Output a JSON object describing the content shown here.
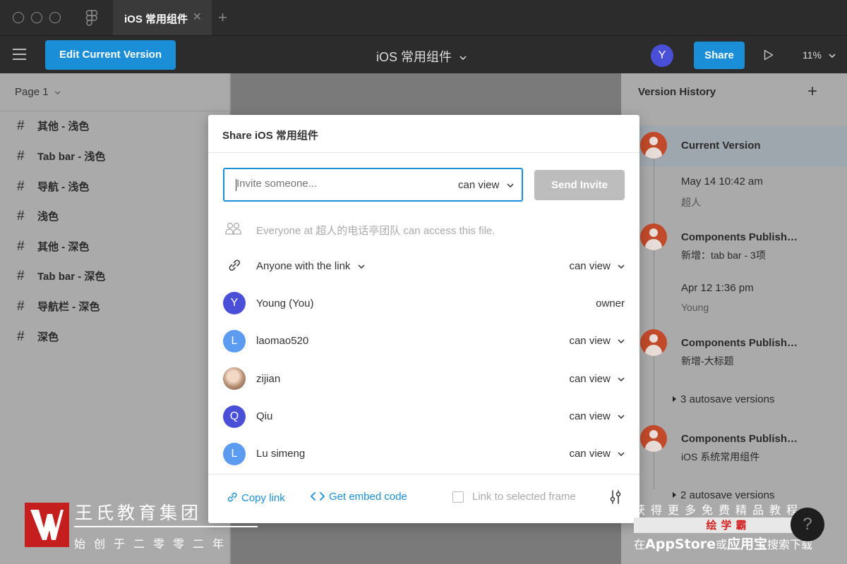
{
  "window": {
    "tab_label": "iOS 常用组件",
    "tab_close": "✕",
    "new_tab": "+"
  },
  "toolbar": {
    "edit_button": "Edit Current Version",
    "file_title": "iOS 常用组件",
    "avatar_initial": "Y",
    "share_button": "Share",
    "zoom": "11%"
  },
  "left_panel": {
    "page_selector": "Page 1",
    "frames": [
      "其他 - 浅色",
      "Tab bar - 浅色",
      "导航 - 浅色",
      "浅色",
      "其他 - 深色",
      "Tab bar - 深色",
      "导航栏 - 深色",
      "深色"
    ]
  },
  "right_panel": {
    "title": "Version History",
    "plus": "+",
    "current_version": "Current Version",
    "v1_date": "May 14 10:42 am",
    "v1_user": "超人",
    "v2_title": "Components Publish…",
    "v2_desc": "新增：tab bar - 3项",
    "v3_date": "Apr 12 1:36 pm",
    "v3_user": "Young",
    "v4_title": "Components Publish…",
    "v4_desc": "新增-大标题",
    "autosave1": "3 autosave versions",
    "v5_title": "Components Publish…",
    "v5_desc": "iOS 系统常用组件",
    "autosave2": "2 autosave versions"
  },
  "modal": {
    "title": "Share iOS 常用组件",
    "invite_placeholder": "Invite someone...",
    "invite_permission": "can view",
    "send_button": "Send Invite",
    "team_access": "Everyone at 超人的电话亭团队 can access this file.",
    "link_access": "Anyone with the link",
    "link_permission": "can view",
    "members": [
      {
        "initial": "Y",
        "name": "Young (You)",
        "permission": "owner",
        "color": "#4a4fd8"
      },
      {
        "initial": "L",
        "name": "laomao520",
        "permission": "can view",
        "color": "#5b9bf0"
      },
      {
        "initial": "",
        "name": "zijian",
        "permission": "can view",
        "color": ""
      },
      {
        "initial": "Q",
        "name": "Qiu",
        "permission": "can view",
        "color": "#4a4fd8"
      },
      {
        "initial": "L",
        "name": "Lu simeng",
        "permission": "can view",
        "color": "#5b9bf0"
      }
    ],
    "copy_link": "Copy link",
    "embed_code": "Get embed code",
    "link_to_frame": "Link to selected frame"
  },
  "watermark": {
    "org_name": "王氏教育集团",
    "org_sub": "始创于二零零二年",
    "right_line1": "获得更多免费精品教程",
    "right_band": "绘学霸",
    "right_line2_prefix": "在",
    "right_line2_app": "AppStore",
    "right_line2_mid": "或",
    "right_line2_store": "应用宝",
    "right_line2_suffix": "搜索下载",
    "help": "?"
  },
  "colors": {
    "accent": "#1a8fd8",
    "version_avatar": "#c24a2a",
    "logo_red": "#c41e1e"
  }
}
